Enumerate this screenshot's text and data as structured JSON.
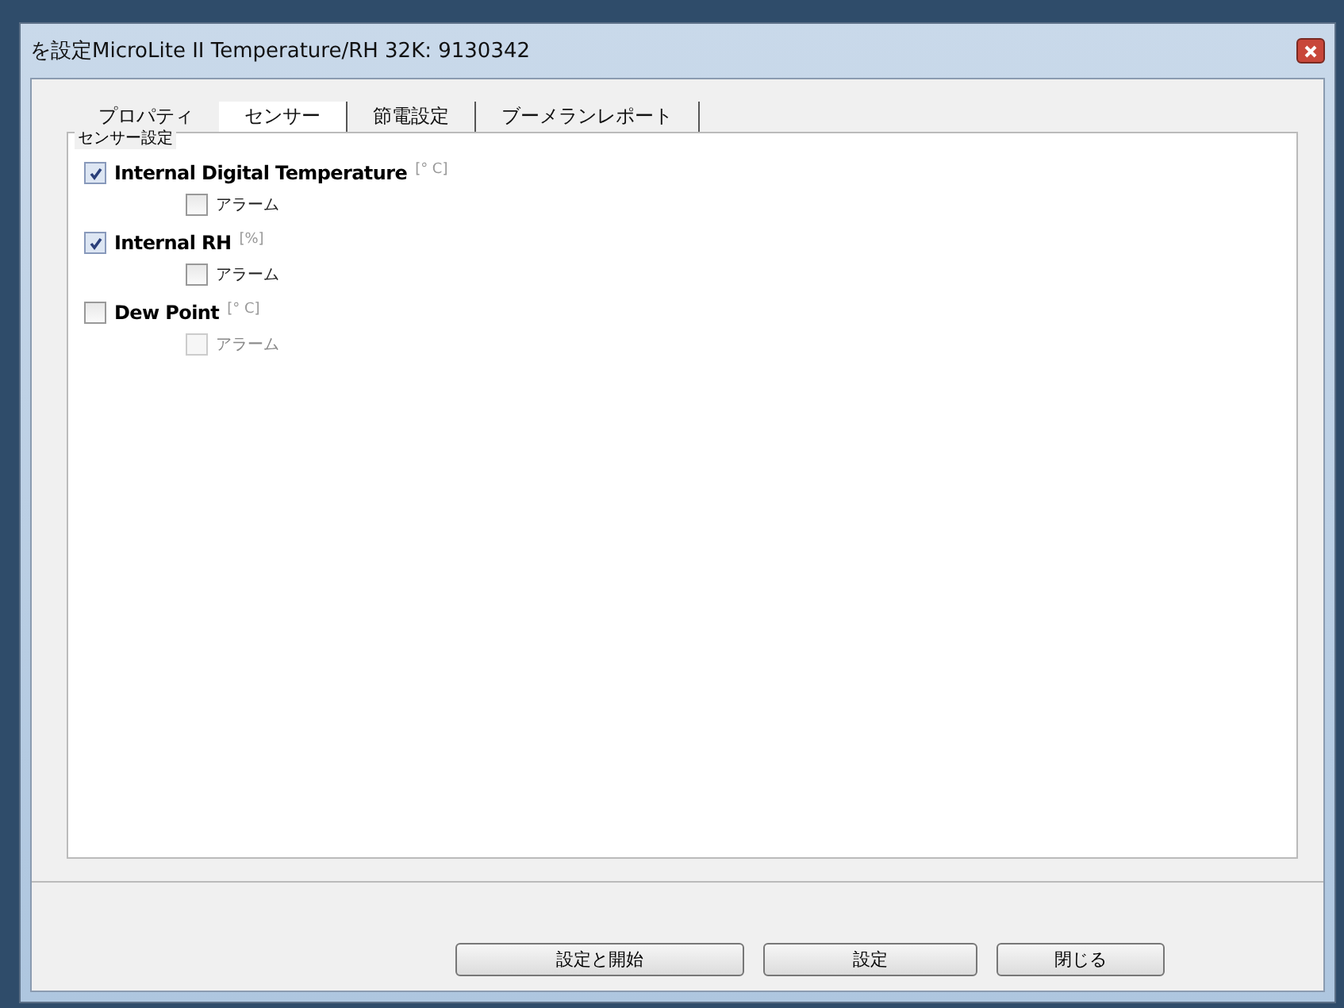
{
  "window": {
    "title": "を設定MicroLite II Temperature/RH 32K: 9130342"
  },
  "tabs": [
    {
      "label": "プロパティ",
      "selected": false
    },
    {
      "label": "センサー",
      "selected": true
    },
    {
      "label": "節電設定",
      "selected": false
    },
    {
      "label": "ブーメランレポート",
      "selected": false
    }
  ],
  "group": {
    "title": "センサー設定"
  },
  "sensors": [
    {
      "name": "Internal Digital Temperature",
      "unit": "[° C]",
      "checked": true,
      "alarm": {
        "label": "アラーム",
        "checked": false,
        "disabled": false
      }
    },
    {
      "name": "Internal RH",
      "unit": "[%]",
      "checked": true,
      "alarm": {
        "label": "アラーム",
        "checked": false,
        "disabled": false
      }
    },
    {
      "name": "Dew Point",
      "unit": "[° C]",
      "checked": false,
      "alarm": {
        "label": "アラーム",
        "checked": false,
        "disabled": true
      }
    }
  ],
  "buttons": [
    "設定と開始",
    "設定",
    "閉じる"
  ]
}
